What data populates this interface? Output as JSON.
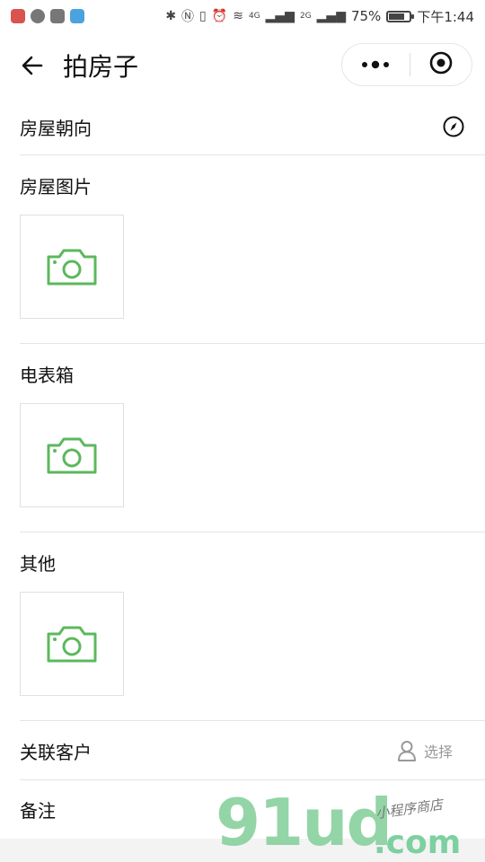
{
  "status_bar": {
    "battery": "75%",
    "time": "下午1:44",
    "network_4g": "4G",
    "network_2g": "2G",
    "battery_level": 0.75
  },
  "nav": {
    "title": "拍房子",
    "menu_icon": "more-dots-icon",
    "close_icon": "target-circle-icon"
  },
  "rows": {
    "orientation_label": "房屋朝向",
    "house_photos_label": "房屋图片",
    "meter_box_label": "电表箱",
    "other_label": "其他",
    "customer_label": "关联客户",
    "customer_action": "选择",
    "remarks_label": "备注"
  },
  "watermark": {
    "main": "91ud",
    "tld": ".com",
    "tag": "小程序商店"
  },
  "colors": {
    "camera_green": "#5cb85c",
    "divider": "#e5e5e5",
    "placeholder_gray": "#999999"
  }
}
